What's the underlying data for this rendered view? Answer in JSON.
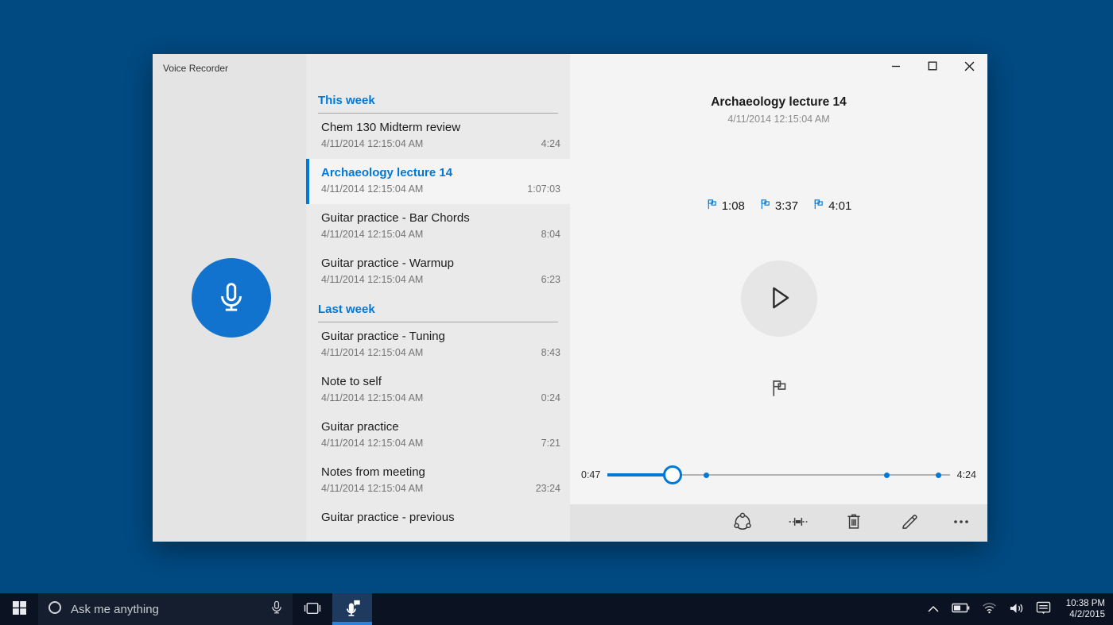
{
  "colors": {
    "accent": "#0078d7",
    "desktop": "#004a82",
    "taskbar": "#0b1322",
    "selected_row": "#f4f4f4"
  },
  "window": {
    "title": "Voice Recorder"
  },
  "recorder": {
    "list": {
      "sections": [
        {
          "label": "This week",
          "items": [
            {
              "title": "Chem 130 Midterm review",
              "date": "4/11/2014 12:15:04 AM",
              "duration": "4:24",
              "selected": false
            },
            {
              "title": "Archaeology lecture 14",
              "date": "4/11/2014 12:15:04 AM",
              "duration": "1:07:03",
              "selected": true
            },
            {
              "title": "Guitar practice - Bar Chords",
              "date": "4/11/2014 12:15:04 AM",
              "duration": "8:04",
              "selected": false
            },
            {
              "title": "Guitar practice - Warmup",
              "date": "4/11/2014 12:15:04 AM",
              "duration": "6:23",
              "selected": false
            }
          ]
        },
        {
          "label": "Last week",
          "items": [
            {
              "title": "Guitar practice - Tuning",
              "date": "4/11/2014 12:15:04 AM",
              "duration": "8:43",
              "selected": false
            },
            {
              "title": "Note to self",
              "date": "4/11/2014 12:15:04 AM",
              "duration": "0:24",
              "selected": false
            },
            {
              "title": "Guitar practice",
              "date": "4/11/2014 12:15:04 AM",
              "duration": "7:21",
              "selected": false
            },
            {
              "title": "Notes from meeting",
              "date": "4/11/2014 12:15:04 AM",
              "duration": "23:24",
              "selected": false
            },
            {
              "title": "Guitar practice - previous",
              "date": "",
              "duration": "",
              "selected": false
            }
          ]
        }
      ]
    },
    "detail": {
      "title": "Archaeology lecture 14",
      "date": "4/11/2014 12:15:04 AM",
      "markers": [
        "1:08",
        "3:37",
        "4:01"
      ],
      "slider": {
        "elapsed": "0:47",
        "total": "4:24",
        "progress_pct": 19,
        "marker_pcts": [
          28.8,
          81.7,
          96.8
        ]
      },
      "toolbar_icons": [
        "share",
        "trim",
        "delete",
        "rename",
        "more"
      ]
    }
  },
  "taskbar": {
    "search": {
      "placeholder": "Ask me anything"
    },
    "tray_icons": [
      "hidden-icons-chevron",
      "battery",
      "wifi",
      "volume",
      "action-center"
    ],
    "clock": {
      "time": "10:38 PM",
      "date": "4/2/2015"
    }
  }
}
